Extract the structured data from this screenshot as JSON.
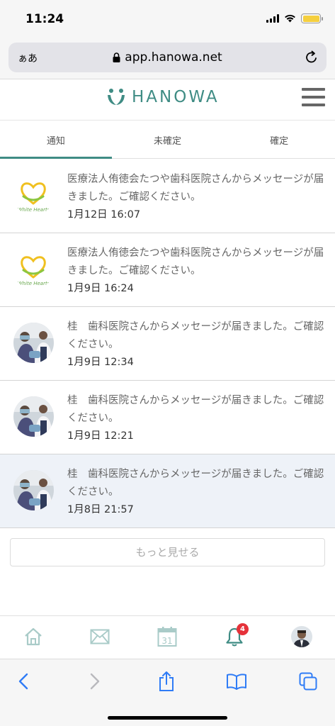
{
  "status_bar": {
    "time": "11:24"
  },
  "browser": {
    "aa_label": "ぁあ",
    "url": "app.hanowa.net"
  },
  "header": {
    "logo_text": "HANOWA"
  },
  "tabs": [
    {
      "label": "通知",
      "active": true
    },
    {
      "label": "未確定",
      "active": false
    },
    {
      "label": "確定",
      "active": false
    }
  ],
  "notifications": [
    {
      "message": "医療法人侑徳会たつや歯科医院さんからメッセージが届きました。ご確認ください。",
      "date": "1月12日 16:07",
      "avatar": "white-hearts-logo",
      "avatar_text": "White Hearts"
    },
    {
      "message": "医療法人侑徳会たつや歯科医院さんからメッセージが届きました。ご確認ください。",
      "date": "1月9日 16:24",
      "avatar": "white-hearts-logo",
      "avatar_text": "White Hearts"
    },
    {
      "message": "桂　歯科医院さんからメッセージが届きました。ご確認ください。",
      "date": "1月9日 12:34",
      "avatar": "clinic-photo"
    },
    {
      "message": "桂　歯科医院さんからメッセージが届きました。ご確認ください。",
      "date": "1月9日 12:21",
      "avatar": "clinic-photo"
    },
    {
      "message": "桂　歯科医院さんからメッセージが届きました。ご確認ください。",
      "date": "1月8日 21:57",
      "avatar": "clinic-photo",
      "highlighted": true
    }
  ],
  "more_button": {
    "label": "もっと見せる"
  },
  "app_nav": {
    "calendar_day": "31",
    "notification_count": "4",
    "icons": [
      "home-icon",
      "mail-icon",
      "calendar-icon",
      "bell-icon",
      "profile-avatar"
    ]
  },
  "colors": {
    "accent": "#3f8c84",
    "badge": "#e5323a",
    "ios_blue": "#2f7cf6"
  }
}
